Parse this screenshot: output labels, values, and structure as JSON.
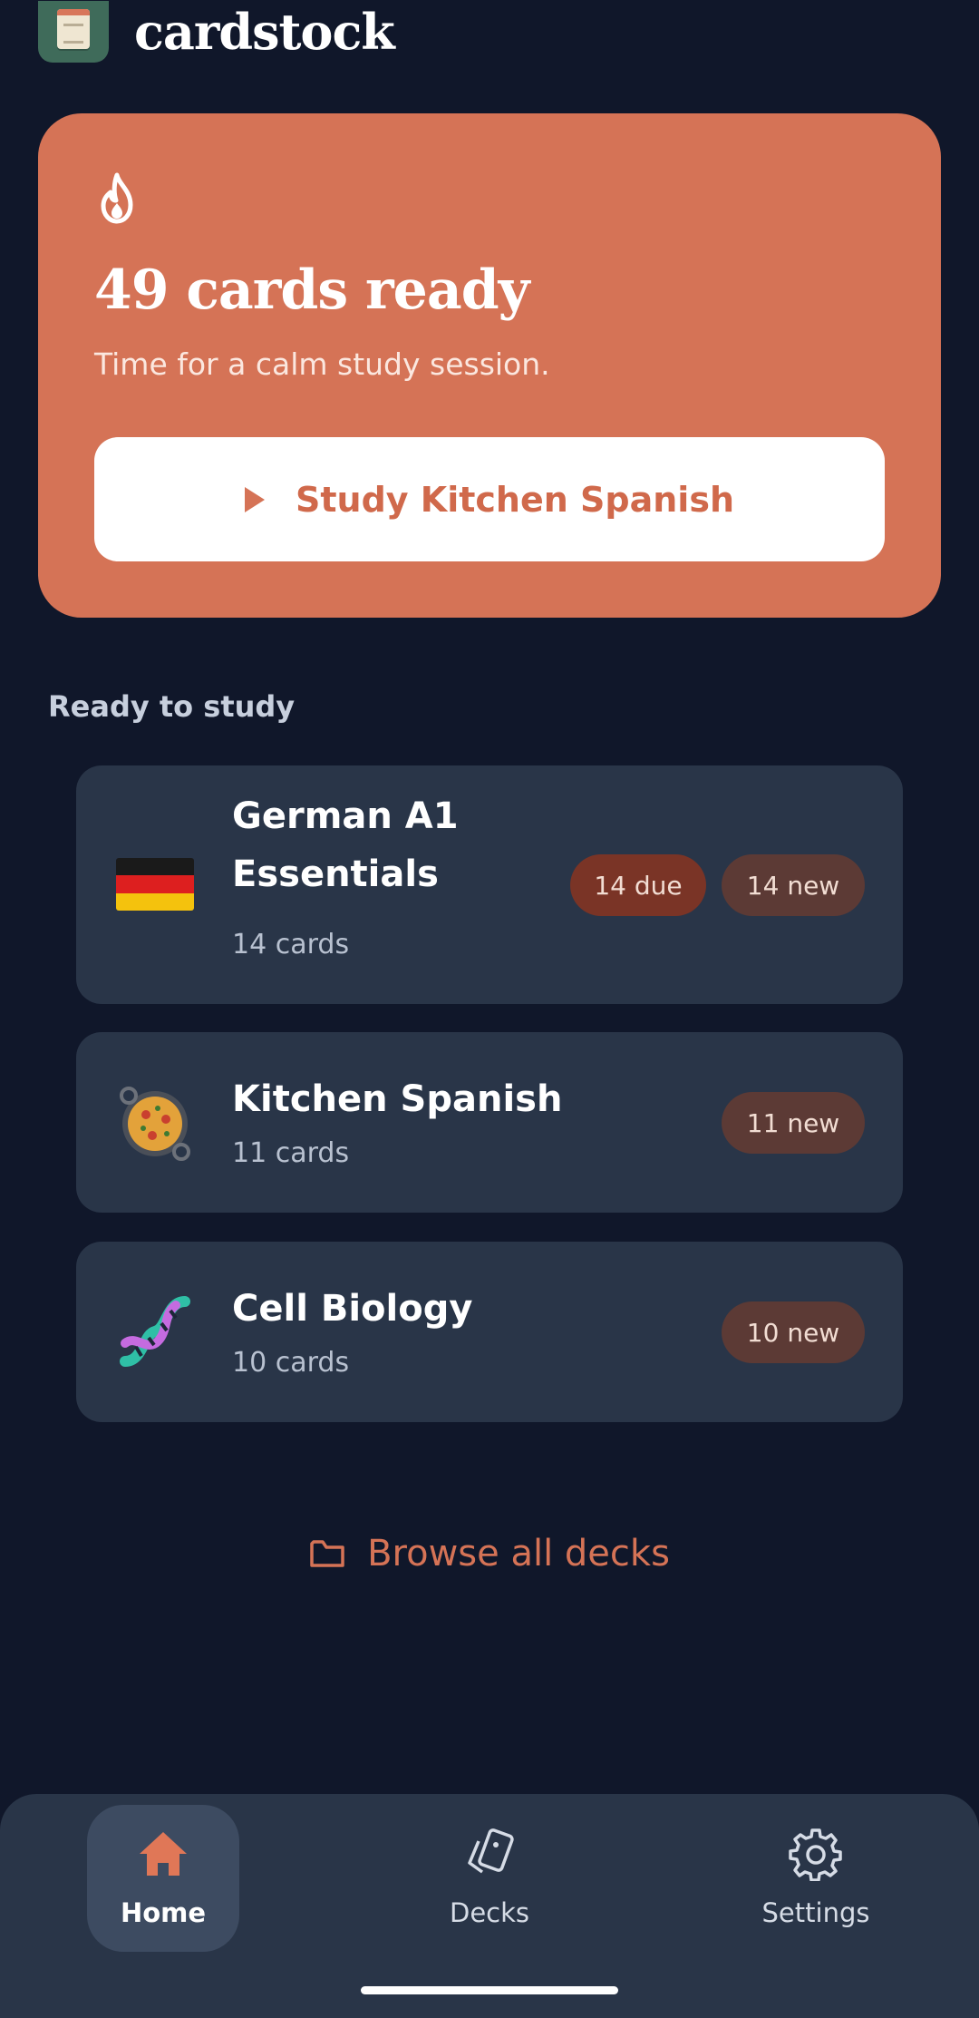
{
  "app": {
    "title": "cardstock"
  },
  "hero": {
    "title": "49 cards ready",
    "subtitle": "Time for a calm study session.",
    "study_button": "Study Kitchen Spanish",
    "accent_color": "#d57356"
  },
  "section": {
    "title": "Ready to study"
  },
  "decks": [
    {
      "name_line1": "German A1",
      "name_line2": "Essentials",
      "count": "14 cards",
      "due": "14 due",
      "new": "14 new",
      "icon": "germany-flag-icon"
    },
    {
      "name_line1": "Kitchen Spanish",
      "count": "11 cards",
      "new": "11 new",
      "icon": "paella-icon"
    },
    {
      "name_line1": "Cell Biology",
      "count": "10 cards",
      "new": "10 new",
      "icon": "dna-icon"
    }
  ],
  "browse": {
    "label": "Browse all decks",
    "icon": "folder-icon"
  },
  "nav": {
    "items": [
      {
        "label": "Home",
        "icon": "home-icon",
        "active": true
      },
      {
        "label": "Decks",
        "icon": "cards-icon",
        "active": false
      },
      {
        "label": "Settings",
        "icon": "gear-icon",
        "active": false
      }
    ]
  }
}
